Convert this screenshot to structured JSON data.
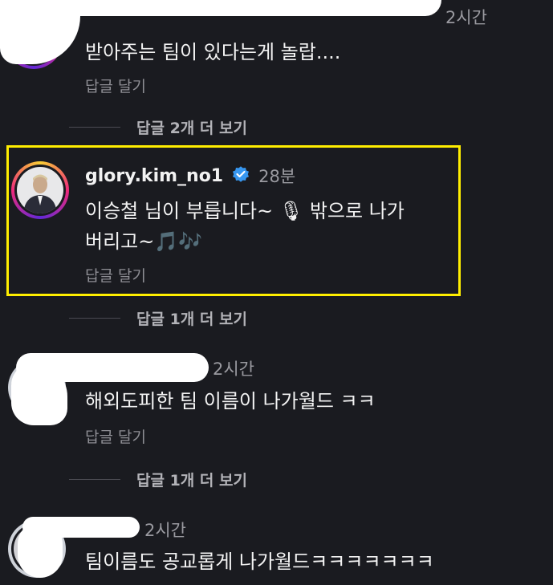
{
  "comments": [
    {
      "username": "",
      "time": "2시간",
      "text": "받아주는 팀이 있다는게 놀랍....",
      "reply_label": "답글 달기",
      "more_replies": "답글 2개 더 보기"
    },
    {
      "username": "glory.kim_no1",
      "time": "28분",
      "text_line1": "이승철 님이 부릅니다~",
      "mic_emoji": "🎙",
      "text_line1_tail": "밖으로 나가",
      "text_line2": "버리고~",
      "notes_emoji": "🎵🎶",
      "reply_label": "답글 달기",
      "more_replies": "답글 1개 더 보기",
      "verified": true,
      "highlight_color": "#ffee00"
    },
    {
      "username": "",
      "time": "2시간",
      "text": "해외도피한 팀 이름이 나가월드 ㅋㅋ",
      "reply_label": "답글 달기",
      "more_replies": "답글 1개 더 보기"
    },
    {
      "username": "",
      "time": "2시간",
      "text": "팀이름도 공교롭게 나가월드ㅋㅋㅋㅋㅋㅋㅋ"
    }
  ],
  "colors": {
    "background": "#1a1b20",
    "verified_badge": "#3797f0"
  }
}
